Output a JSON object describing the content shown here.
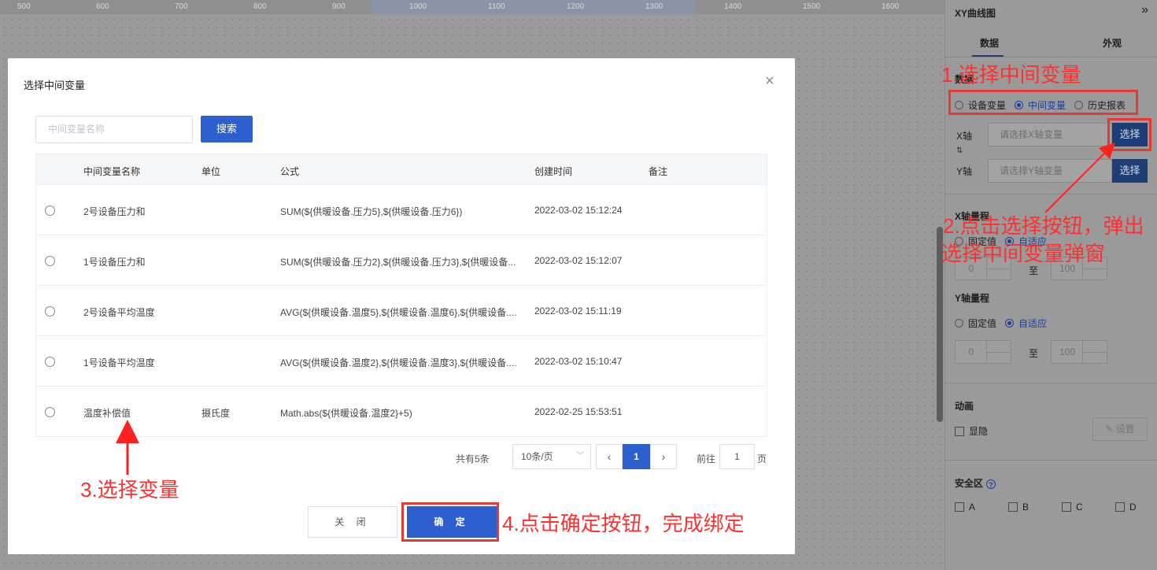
{
  "ruler": {
    "ticks": [
      "500",
      "600",
      "700",
      "800",
      "900",
      "1000",
      "1100",
      "1200",
      "1300",
      "1400",
      "1500",
      "1600"
    ]
  },
  "panel": {
    "title": "XY曲线图",
    "collapse_icon": "»",
    "tabs": [
      "数据",
      "外观"
    ],
    "source_section": "数据",
    "source_options": [
      "设备变量",
      "中间变量",
      "历史报表"
    ],
    "source_selected": "中间变量",
    "x_axis_label": "X轴",
    "y_axis_label": "Y轴",
    "x_placeholder": "请选择X轴变量",
    "y_placeholder": "请选择Y轴变量",
    "select_btn": "选择",
    "swap_icon": "⇅",
    "x_range_title": "X轴量程",
    "y_range_title": "Y轴量程",
    "range_options": [
      "固定值",
      "自适应"
    ],
    "range_min": "0",
    "range_max": "100",
    "range_to": "至",
    "anim_title": "动画",
    "anim_option": "显隐",
    "anim_btn": "设置",
    "safe_title": "安全区",
    "safe_options": [
      "A",
      "B",
      "C",
      "D"
    ],
    "help_icon": "?"
  },
  "dialog": {
    "title": "选择中间变量",
    "close_icon": "×",
    "search_placeholder": "中间变量名称",
    "search_btn": "搜索",
    "columns": [
      "中间变量名称",
      "单位",
      "公式",
      "创建时间",
      "备注"
    ],
    "rows": [
      {
        "name": "2号设备压力和",
        "unit": "",
        "formula": "SUM(${供暖设备.压力5},${供暖设备.压力6})",
        "time": "2022-03-02 15:12:24",
        "note": ""
      },
      {
        "name": "1号设备压力和",
        "unit": "",
        "formula": "SUM(${供暖设备.压力2},${供暖设备.压力3},${供暖设备...",
        "time": "2022-03-02 15:12:07",
        "note": ""
      },
      {
        "name": "2号设备平均温度",
        "unit": "",
        "formula": "AVG(${供暖设备.温度5},${供暖设备.温度6},${供暖设备....",
        "time": "2022-03-02 15:11:19",
        "note": ""
      },
      {
        "name": "1号设备平均温度",
        "unit": "",
        "formula": "AVG(${供暖设备.温度2},${供暖设备.温度3},${供暖设备....",
        "time": "2022-03-02 15:10:47",
        "note": ""
      },
      {
        "name": "温度补偿值",
        "unit": "摄氏度",
        "formula": "Math.abs(${供暖设备.温度2}+5)",
        "time": "2022-02-25 15:53:51",
        "note": ""
      }
    ],
    "pager": {
      "total": "共有5条",
      "page_size": "10条/页",
      "prev_icon": "‹",
      "next_icon": "›",
      "current": "1",
      "goto_label": "前往",
      "goto_value": "1",
      "goto_suffix": "页"
    },
    "close_btn": "关 闭",
    "ok_btn": "确 定"
  },
  "annotations": {
    "step1": "1.选择中间变量",
    "step2_line1": "2.点击选择按钮，弹出",
    "step2_line2": "选择中间变量弹窗",
    "step3": "3.选择变量",
    "step4": "4.点击确定按钮，完成绑定"
  },
  "colors": {
    "primary": "#2d5fcf",
    "annotation": "#ff3030",
    "dark_btn": "#1f3d75"
  }
}
